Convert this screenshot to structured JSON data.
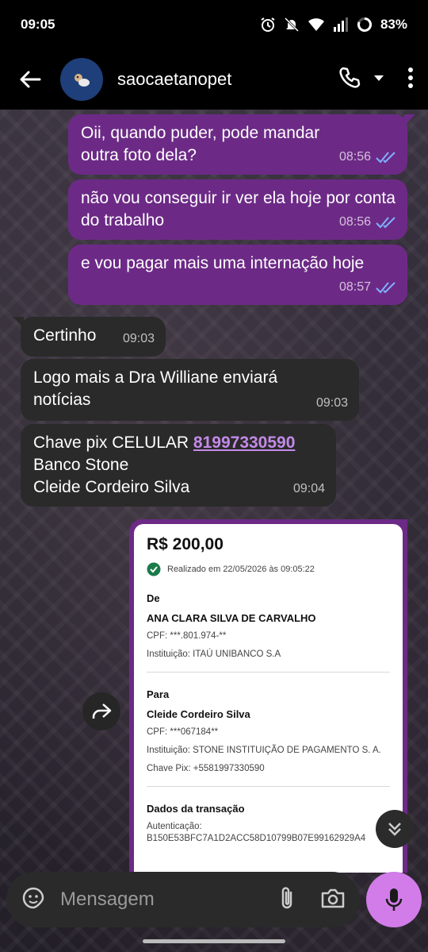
{
  "status": {
    "time": "09:05",
    "battery": "83%"
  },
  "header": {
    "contact_name": "saocaetanopet"
  },
  "messages": [
    {
      "dir": "out",
      "text": "Oii, quando puder, pode mandar outra foto dela?",
      "time": "08:56"
    },
    {
      "dir": "out",
      "text": "não vou conseguir ir ver ela hoje por conta do trabalho",
      "time": "08:56"
    },
    {
      "dir": "out",
      "text": "e vou pagar mais uma internação hoje",
      "time": "08:57"
    },
    {
      "dir": "in",
      "text": "Certinho",
      "time": "09:03"
    },
    {
      "dir": "in",
      "text": "Logo mais a Dra Williane enviará notícias",
      "time": "09:03"
    },
    {
      "dir": "in",
      "line1_prefix": "Chave pix CELULAR ",
      "line1_link": "81997330590",
      "line2": "Banco Stone",
      "line3": "Cleide Cordeiro Silva",
      "time": "09:04"
    }
  ],
  "receipt": {
    "amount": "R$ 200,00",
    "status": "Realizado em 22/05/2026 às 09:05:22",
    "from_heading": "De",
    "from_name": "ANA CLARA SILVA DE CARVALHO",
    "from_cpf": "CPF:  ***.801.974-**",
    "from_institution": "Instituição:  ITAÚ UNIBANCO S.A",
    "to_heading": "Para",
    "to_name": "Cleide Cordeiro Silva",
    "to_cpf": "CPF:  ***067184**",
    "to_institution": "Instituição:  STONE INSTITUIÇÃO DE PAGAMENTO S. A.",
    "to_pix": "Chave Pix:  +5581997330590",
    "tx_heading": "Dados da transação",
    "tx_auth_label": "Autenticação:",
    "tx_auth_value": "B150E53BFC7A1D2ACC58D10799B07E99162929A4"
  },
  "input": {
    "placeholder": "Mensagem"
  },
  "colors": {
    "outgoing": "#6c2a86",
    "incoming": "#2a2a2a",
    "accent": "#d17ce8",
    "read_ticks": "#7fb2ff"
  }
}
